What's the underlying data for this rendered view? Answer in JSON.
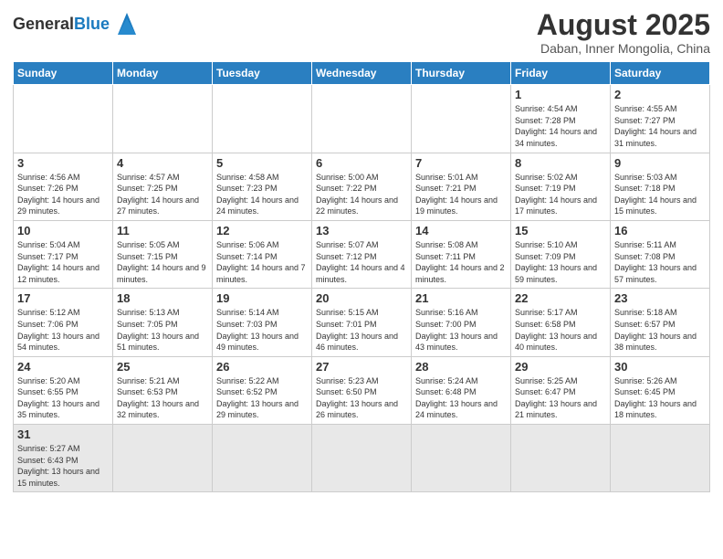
{
  "logo": {
    "text_general": "General",
    "text_blue": "Blue"
  },
  "header": {
    "title": "August 2025",
    "subtitle": "Daban, Inner Mongolia, China"
  },
  "weekdays": [
    "Sunday",
    "Monday",
    "Tuesday",
    "Wednesday",
    "Thursday",
    "Friday",
    "Saturday"
  ],
  "weeks": [
    [
      {
        "day": "",
        "info": ""
      },
      {
        "day": "",
        "info": ""
      },
      {
        "day": "",
        "info": ""
      },
      {
        "day": "",
        "info": ""
      },
      {
        "day": "",
        "info": ""
      },
      {
        "day": "1",
        "info": "Sunrise: 4:54 AM\nSunset: 7:28 PM\nDaylight: 14 hours and 34 minutes."
      },
      {
        "day": "2",
        "info": "Sunrise: 4:55 AM\nSunset: 7:27 PM\nDaylight: 14 hours and 31 minutes."
      }
    ],
    [
      {
        "day": "3",
        "info": "Sunrise: 4:56 AM\nSunset: 7:26 PM\nDaylight: 14 hours and 29 minutes."
      },
      {
        "day": "4",
        "info": "Sunrise: 4:57 AM\nSunset: 7:25 PM\nDaylight: 14 hours and 27 minutes."
      },
      {
        "day": "5",
        "info": "Sunrise: 4:58 AM\nSunset: 7:23 PM\nDaylight: 14 hours and 24 minutes."
      },
      {
        "day": "6",
        "info": "Sunrise: 5:00 AM\nSunset: 7:22 PM\nDaylight: 14 hours and 22 minutes."
      },
      {
        "day": "7",
        "info": "Sunrise: 5:01 AM\nSunset: 7:21 PM\nDaylight: 14 hours and 19 minutes."
      },
      {
        "day": "8",
        "info": "Sunrise: 5:02 AM\nSunset: 7:19 PM\nDaylight: 14 hours and 17 minutes."
      },
      {
        "day": "9",
        "info": "Sunrise: 5:03 AM\nSunset: 7:18 PM\nDaylight: 14 hours and 15 minutes."
      }
    ],
    [
      {
        "day": "10",
        "info": "Sunrise: 5:04 AM\nSunset: 7:17 PM\nDaylight: 14 hours and 12 minutes."
      },
      {
        "day": "11",
        "info": "Sunrise: 5:05 AM\nSunset: 7:15 PM\nDaylight: 14 hours and 9 minutes."
      },
      {
        "day": "12",
        "info": "Sunrise: 5:06 AM\nSunset: 7:14 PM\nDaylight: 14 hours and 7 minutes."
      },
      {
        "day": "13",
        "info": "Sunrise: 5:07 AM\nSunset: 7:12 PM\nDaylight: 14 hours and 4 minutes."
      },
      {
        "day": "14",
        "info": "Sunrise: 5:08 AM\nSunset: 7:11 PM\nDaylight: 14 hours and 2 minutes."
      },
      {
        "day": "15",
        "info": "Sunrise: 5:10 AM\nSunset: 7:09 PM\nDaylight: 13 hours and 59 minutes."
      },
      {
        "day": "16",
        "info": "Sunrise: 5:11 AM\nSunset: 7:08 PM\nDaylight: 13 hours and 57 minutes."
      }
    ],
    [
      {
        "day": "17",
        "info": "Sunrise: 5:12 AM\nSunset: 7:06 PM\nDaylight: 13 hours and 54 minutes."
      },
      {
        "day": "18",
        "info": "Sunrise: 5:13 AM\nSunset: 7:05 PM\nDaylight: 13 hours and 51 minutes."
      },
      {
        "day": "19",
        "info": "Sunrise: 5:14 AM\nSunset: 7:03 PM\nDaylight: 13 hours and 49 minutes."
      },
      {
        "day": "20",
        "info": "Sunrise: 5:15 AM\nSunset: 7:01 PM\nDaylight: 13 hours and 46 minutes."
      },
      {
        "day": "21",
        "info": "Sunrise: 5:16 AM\nSunset: 7:00 PM\nDaylight: 13 hours and 43 minutes."
      },
      {
        "day": "22",
        "info": "Sunrise: 5:17 AM\nSunset: 6:58 PM\nDaylight: 13 hours and 40 minutes."
      },
      {
        "day": "23",
        "info": "Sunrise: 5:18 AM\nSunset: 6:57 PM\nDaylight: 13 hours and 38 minutes."
      }
    ],
    [
      {
        "day": "24",
        "info": "Sunrise: 5:20 AM\nSunset: 6:55 PM\nDaylight: 13 hours and 35 minutes."
      },
      {
        "day": "25",
        "info": "Sunrise: 5:21 AM\nSunset: 6:53 PM\nDaylight: 13 hours and 32 minutes."
      },
      {
        "day": "26",
        "info": "Sunrise: 5:22 AM\nSunset: 6:52 PM\nDaylight: 13 hours and 29 minutes."
      },
      {
        "day": "27",
        "info": "Sunrise: 5:23 AM\nSunset: 6:50 PM\nDaylight: 13 hours and 26 minutes."
      },
      {
        "day": "28",
        "info": "Sunrise: 5:24 AM\nSunset: 6:48 PM\nDaylight: 13 hours and 24 minutes."
      },
      {
        "day": "29",
        "info": "Sunrise: 5:25 AM\nSunset: 6:47 PM\nDaylight: 13 hours and 21 minutes."
      },
      {
        "day": "30",
        "info": "Sunrise: 5:26 AM\nSunset: 6:45 PM\nDaylight: 13 hours and 18 minutes."
      }
    ],
    [
      {
        "day": "31",
        "info": "Sunrise: 5:27 AM\nSunset: 6:43 PM\nDaylight: 13 hours and 15 minutes."
      },
      {
        "day": "",
        "info": ""
      },
      {
        "day": "",
        "info": ""
      },
      {
        "day": "",
        "info": ""
      },
      {
        "day": "",
        "info": ""
      },
      {
        "day": "",
        "info": ""
      },
      {
        "day": "",
        "info": ""
      }
    ]
  ]
}
